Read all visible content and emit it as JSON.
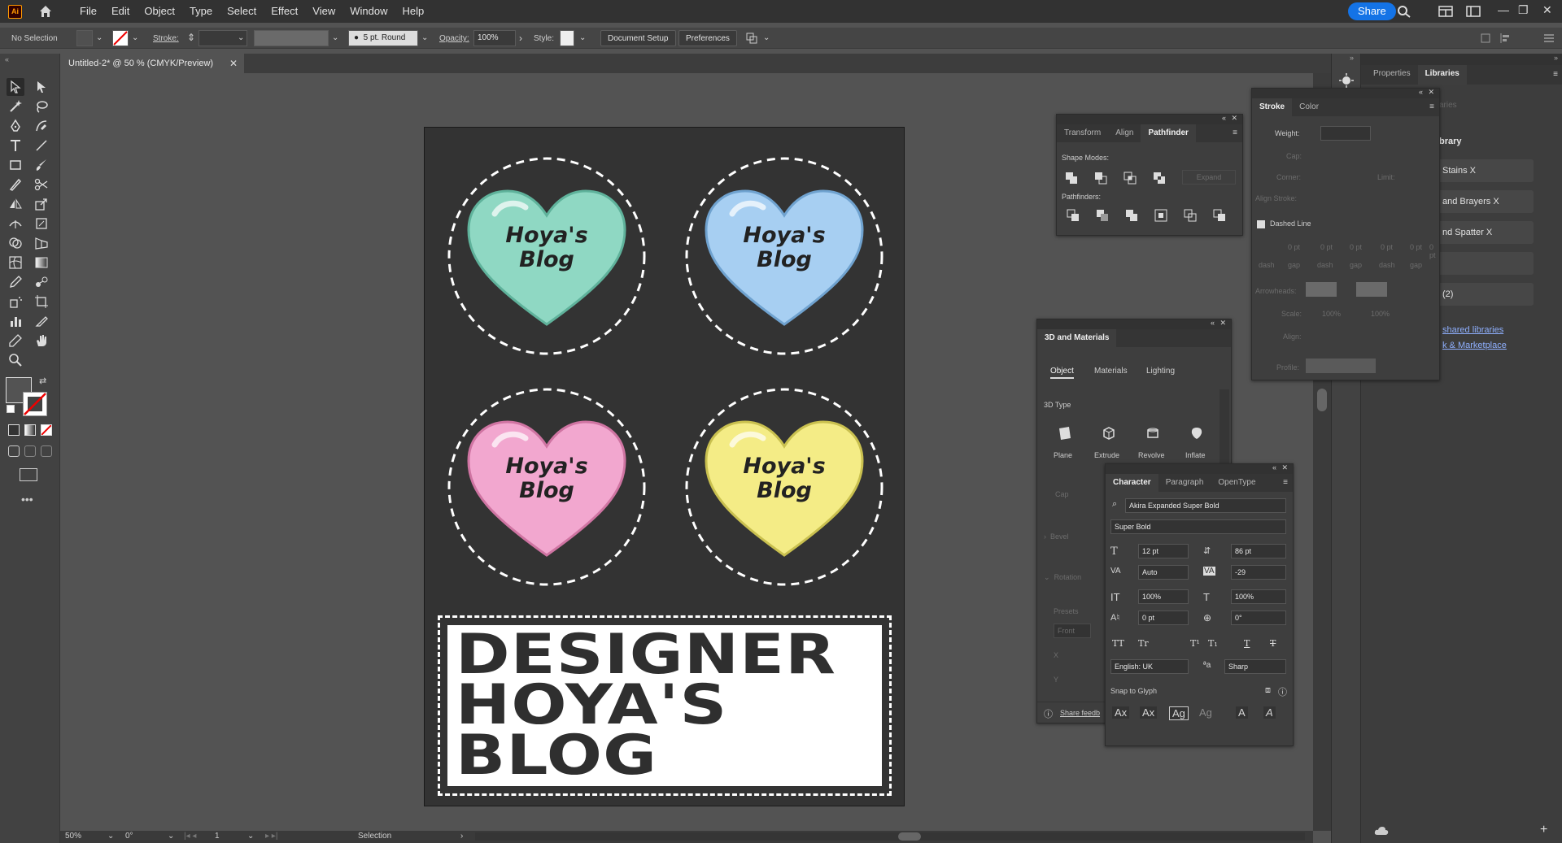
{
  "app": {
    "logo": "Ai"
  },
  "menu": [
    "File",
    "Edit",
    "Object",
    "Type",
    "Select",
    "Effect",
    "View",
    "Window",
    "Help"
  ],
  "share_label": "Share",
  "control_bar": {
    "selection": "No Selection",
    "stroke_label": "Stroke:",
    "brush": "5 pt. Round",
    "opacity_label": "Opacity:",
    "opacity_value": "100%",
    "style_label": "Style:",
    "document_setup": "Document Setup",
    "preferences": "Preferences"
  },
  "document": {
    "tab_title": "Untitled-2* @ 50 % (CMYK/Preview)"
  },
  "artwork": {
    "sticker_text_1": "Hoya's",
    "sticker_text_2": "Blog",
    "heart_colors": [
      "#8fd8c3",
      "#a7cff2",
      "#f2a7cf",
      "#f4ec86"
    ],
    "title_lines": [
      "DESIGNER",
      "HOYA'S",
      "BLOG"
    ]
  },
  "status_bar": {
    "zoom": "50%",
    "rotation": "0°",
    "artboard": "1",
    "tool": "Selection"
  },
  "pathfinder_panel": {
    "tabs": [
      "Transform",
      "Align",
      "Pathfinder"
    ],
    "shape_modes": "Shape Modes:",
    "expand": "Expand",
    "pathfinders": "Pathfinders:"
  },
  "stroke_panel": {
    "tabs": [
      "Stroke",
      "Color"
    ],
    "weight": "Weight:",
    "cap": "Cap:",
    "corner": "Corner:",
    "limit": "Limit:",
    "align_stroke": "Align Stroke:",
    "dashed_line": "Dashed Line",
    "dash_values": [
      "0 pt",
      "0 pt",
      "0 pt",
      "0 pt",
      "0 pt",
      "0 pt"
    ],
    "dash_labels": [
      "dash",
      "gap",
      "dash",
      "gap",
      "dash",
      "gap"
    ],
    "arrowheads": "Arrowheads:",
    "scale": "Scale:",
    "scale_values": [
      "100%",
      "100%"
    ],
    "align": "Align:",
    "profile": "Profile:"
  },
  "materials_panel": {
    "title": "3D and Materials",
    "subtabs": [
      "Object",
      "Materials",
      "Lighting"
    ],
    "type_label": "3D Type",
    "types": [
      "Plane",
      "Extrude",
      "Revolve",
      "Inflate"
    ],
    "cap": "Cap",
    "bevel": "Bevel",
    "rotation": "Rotation",
    "presets": "Presets",
    "preset_value": "Front",
    "x": "X",
    "y": "Y",
    "share_feedback": "Share feedb"
  },
  "character_panel": {
    "tabs": [
      "Character",
      "Paragraph",
      "OpenType"
    ],
    "font": "Akira Expanded Super Bold",
    "style": "Super Bold",
    "size": "12 pt",
    "leading": "86 pt",
    "kerning": "Auto",
    "tracking": "-29",
    "vscale": "100%",
    "hscale": "100%",
    "baseline": "0 pt",
    "rotation": "0°",
    "language": "English: UK",
    "aa": "Sharp",
    "snap": "Snap to Glyph"
  },
  "libraries_panel": {
    "tabs": [
      "Properties",
      "Libraries"
    ],
    "search_hint": "aries",
    "library_heading": "brary",
    "items": [
      "Stains X",
      "and Brayers X",
      "nd Spatter X",
      "",
      "(2)"
    ],
    "links": [
      "shared libraries",
      "k & Marketplace"
    ]
  }
}
